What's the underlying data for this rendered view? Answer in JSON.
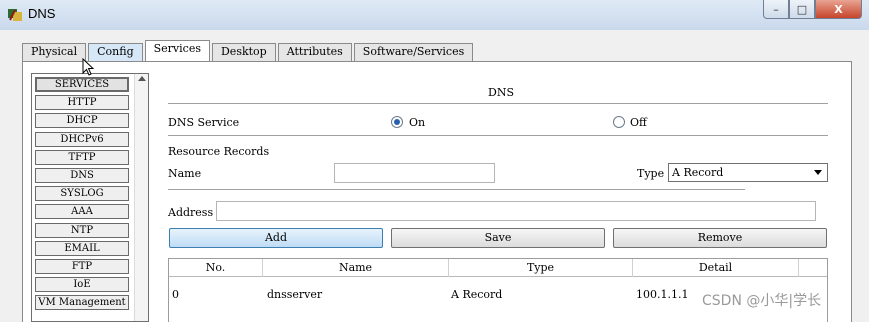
{
  "window": {
    "title": "DNS",
    "buttons": {
      "minimize": "–",
      "maximize": "□",
      "close": "X"
    }
  },
  "tabs": [
    {
      "label": "Physical"
    },
    {
      "label": "Config"
    },
    {
      "label": "Services"
    },
    {
      "label": "Desktop"
    },
    {
      "label": "Attributes"
    },
    {
      "label": "Software/Services"
    }
  ],
  "sidebar": {
    "header": "SERVICES",
    "items": [
      "HTTP",
      "DHCP",
      "DHCPv6",
      "TFTP",
      "DNS",
      "SYSLOG",
      "AAA",
      "NTP",
      "EMAIL",
      "FTP",
      "IoE",
      "VM Management"
    ]
  },
  "dns": {
    "heading": "DNS",
    "service_label": "DNS Service",
    "on_label": "On",
    "off_label": "Off",
    "selected": "On",
    "records_label": "Resource Records",
    "name_label": "Name",
    "name_value": "",
    "type_label": "Type",
    "type_value": "A Record",
    "address_label": "Address",
    "address_value": "",
    "add_label": "Add",
    "save_label": "Save",
    "remove_label": "Remove"
  },
  "table": {
    "columns": [
      "No.",
      "Name",
      "Type",
      "Detail"
    ],
    "rows": [
      {
        "no": "0",
        "name": "dnsserver",
        "type": "A Record",
        "detail": "100.1.1.1"
      }
    ]
  },
  "watermark": "CSDN @小华|学长"
}
